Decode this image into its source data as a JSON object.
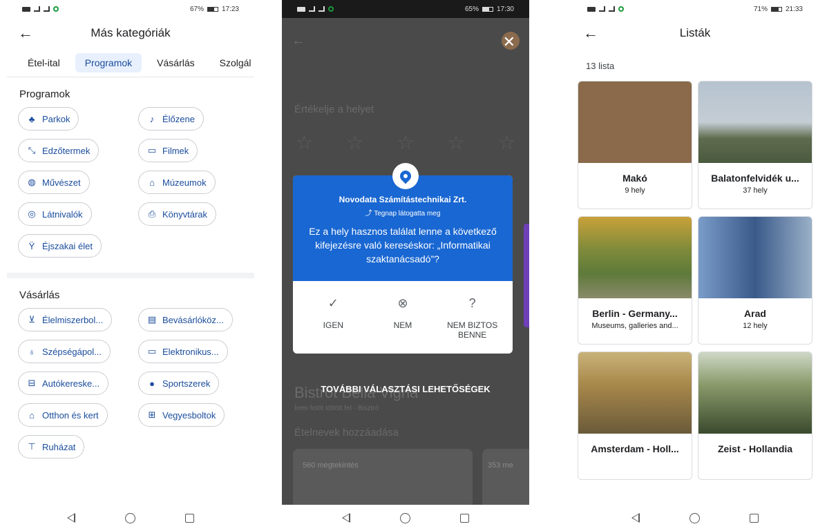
{
  "status_bars": {
    "p1": {
      "time": "17:23",
      "battery": "67%"
    },
    "p2": {
      "time": "17:30",
      "battery": "65%"
    },
    "p3": {
      "time": "21:33",
      "battery": "71%"
    }
  },
  "panel1": {
    "title": "Más kategóriák",
    "tabs": [
      {
        "label": "Étel-ital"
      },
      {
        "label": "Programok"
      },
      {
        "label": "Vásárlás"
      },
      {
        "label": "Szolgál"
      }
    ],
    "sections": [
      {
        "title": "Programok",
        "chips": [
          {
            "label": "Parkok",
            "icon": "park-icon",
            "glyph": "♣"
          },
          {
            "label": "Élőzene",
            "icon": "music-note-icon",
            "glyph": "♪"
          },
          {
            "label": "Edzőtermek",
            "icon": "dumbbell-icon",
            "glyph": "⤡"
          },
          {
            "label": "Filmek",
            "icon": "movie-icon",
            "glyph": "▭"
          },
          {
            "label": "Művészet",
            "icon": "palette-icon",
            "glyph": "◍"
          },
          {
            "label": "Múzeumok",
            "icon": "museum-icon",
            "glyph": "⌂"
          },
          {
            "label": "Látnivalók",
            "icon": "camera-icon",
            "glyph": "◎"
          },
          {
            "label": "Könyvtárak",
            "icon": "library-icon",
            "glyph": "⎙"
          },
          {
            "label": "Éjszakai élet",
            "icon": "nightlife-icon",
            "glyph": "Ÿ"
          }
        ]
      },
      {
        "title": "Vásárlás",
        "chips": [
          {
            "label": "Élelmiszerbol...",
            "icon": "cart-icon",
            "glyph": "⊻"
          },
          {
            "label": "Bevásárlóköz...",
            "icon": "mall-icon",
            "glyph": "▤"
          },
          {
            "label": "Szépségápol...",
            "icon": "beauty-icon",
            "glyph": "♁"
          },
          {
            "label": "Elektronikus...",
            "icon": "electronics-icon",
            "glyph": "▭"
          },
          {
            "label": "Autókereske...",
            "icon": "car-icon",
            "glyph": "⊟"
          },
          {
            "label": "Sportszerek",
            "icon": "sports-icon",
            "glyph": "●"
          },
          {
            "label": "Otthon és kert",
            "icon": "home-garden-icon",
            "glyph": "⌂"
          },
          {
            "label": "Vegyesboltok",
            "icon": "store-icon",
            "glyph": "⊞"
          },
          {
            "label": "Ruházat",
            "icon": "shirt-icon",
            "glyph": "⊤"
          }
        ]
      }
    ]
  },
  "panel2": {
    "rate_label": "Értékelje a helyet",
    "place_name": "Novodata Számítástechnikai Zrt.",
    "visited": "Tegnap látogatta meg",
    "question": "Ez a hely hasznos találat lenne a következő kifejezésre való kereséskor: „Informatikai szaktanácsadó”?",
    "actions": [
      {
        "label": "IGEN",
        "icon": "check-circle-icon",
        "glyph": "✓"
      },
      {
        "label": "NEM",
        "icon": "x-circle-icon",
        "glyph": "⊗"
      },
      {
        "label": "NEM BIZTOS BENNE",
        "icon": "question-circle-icon",
        "glyph": "?"
      }
    ],
    "more_options": "TOVÁBBI VÁLASZTÁSI LEHETŐSÉGEK",
    "bg_place": "Bistrot Bella Vigna",
    "bg_sub": "Írem fotót töltött fel · Bisztró",
    "bg_dishes": "Ételnevek hozzáadása",
    "bg_views1": "560 megtekintés",
    "bg_views2": "353 me"
  },
  "panel3": {
    "title": "Listák",
    "count": "13 lista",
    "lists": [
      {
        "name": "Makó",
        "sub": "9 hely"
      },
      {
        "name": "Balatonfelvidék u...",
        "sub": "37 hely"
      },
      {
        "name": "Berlin - Germany...",
        "sub": "Museums, galleries and..."
      },
      {
        "name": "Arad",
        "sub": "12 hely"
      },
      {
        "name": "Amsterdam - Holl...",
        "sub": ""
      },
      {
        "name": "Zeist - Hollandia",
        "sub": ""
      }
    ]
  }
}
